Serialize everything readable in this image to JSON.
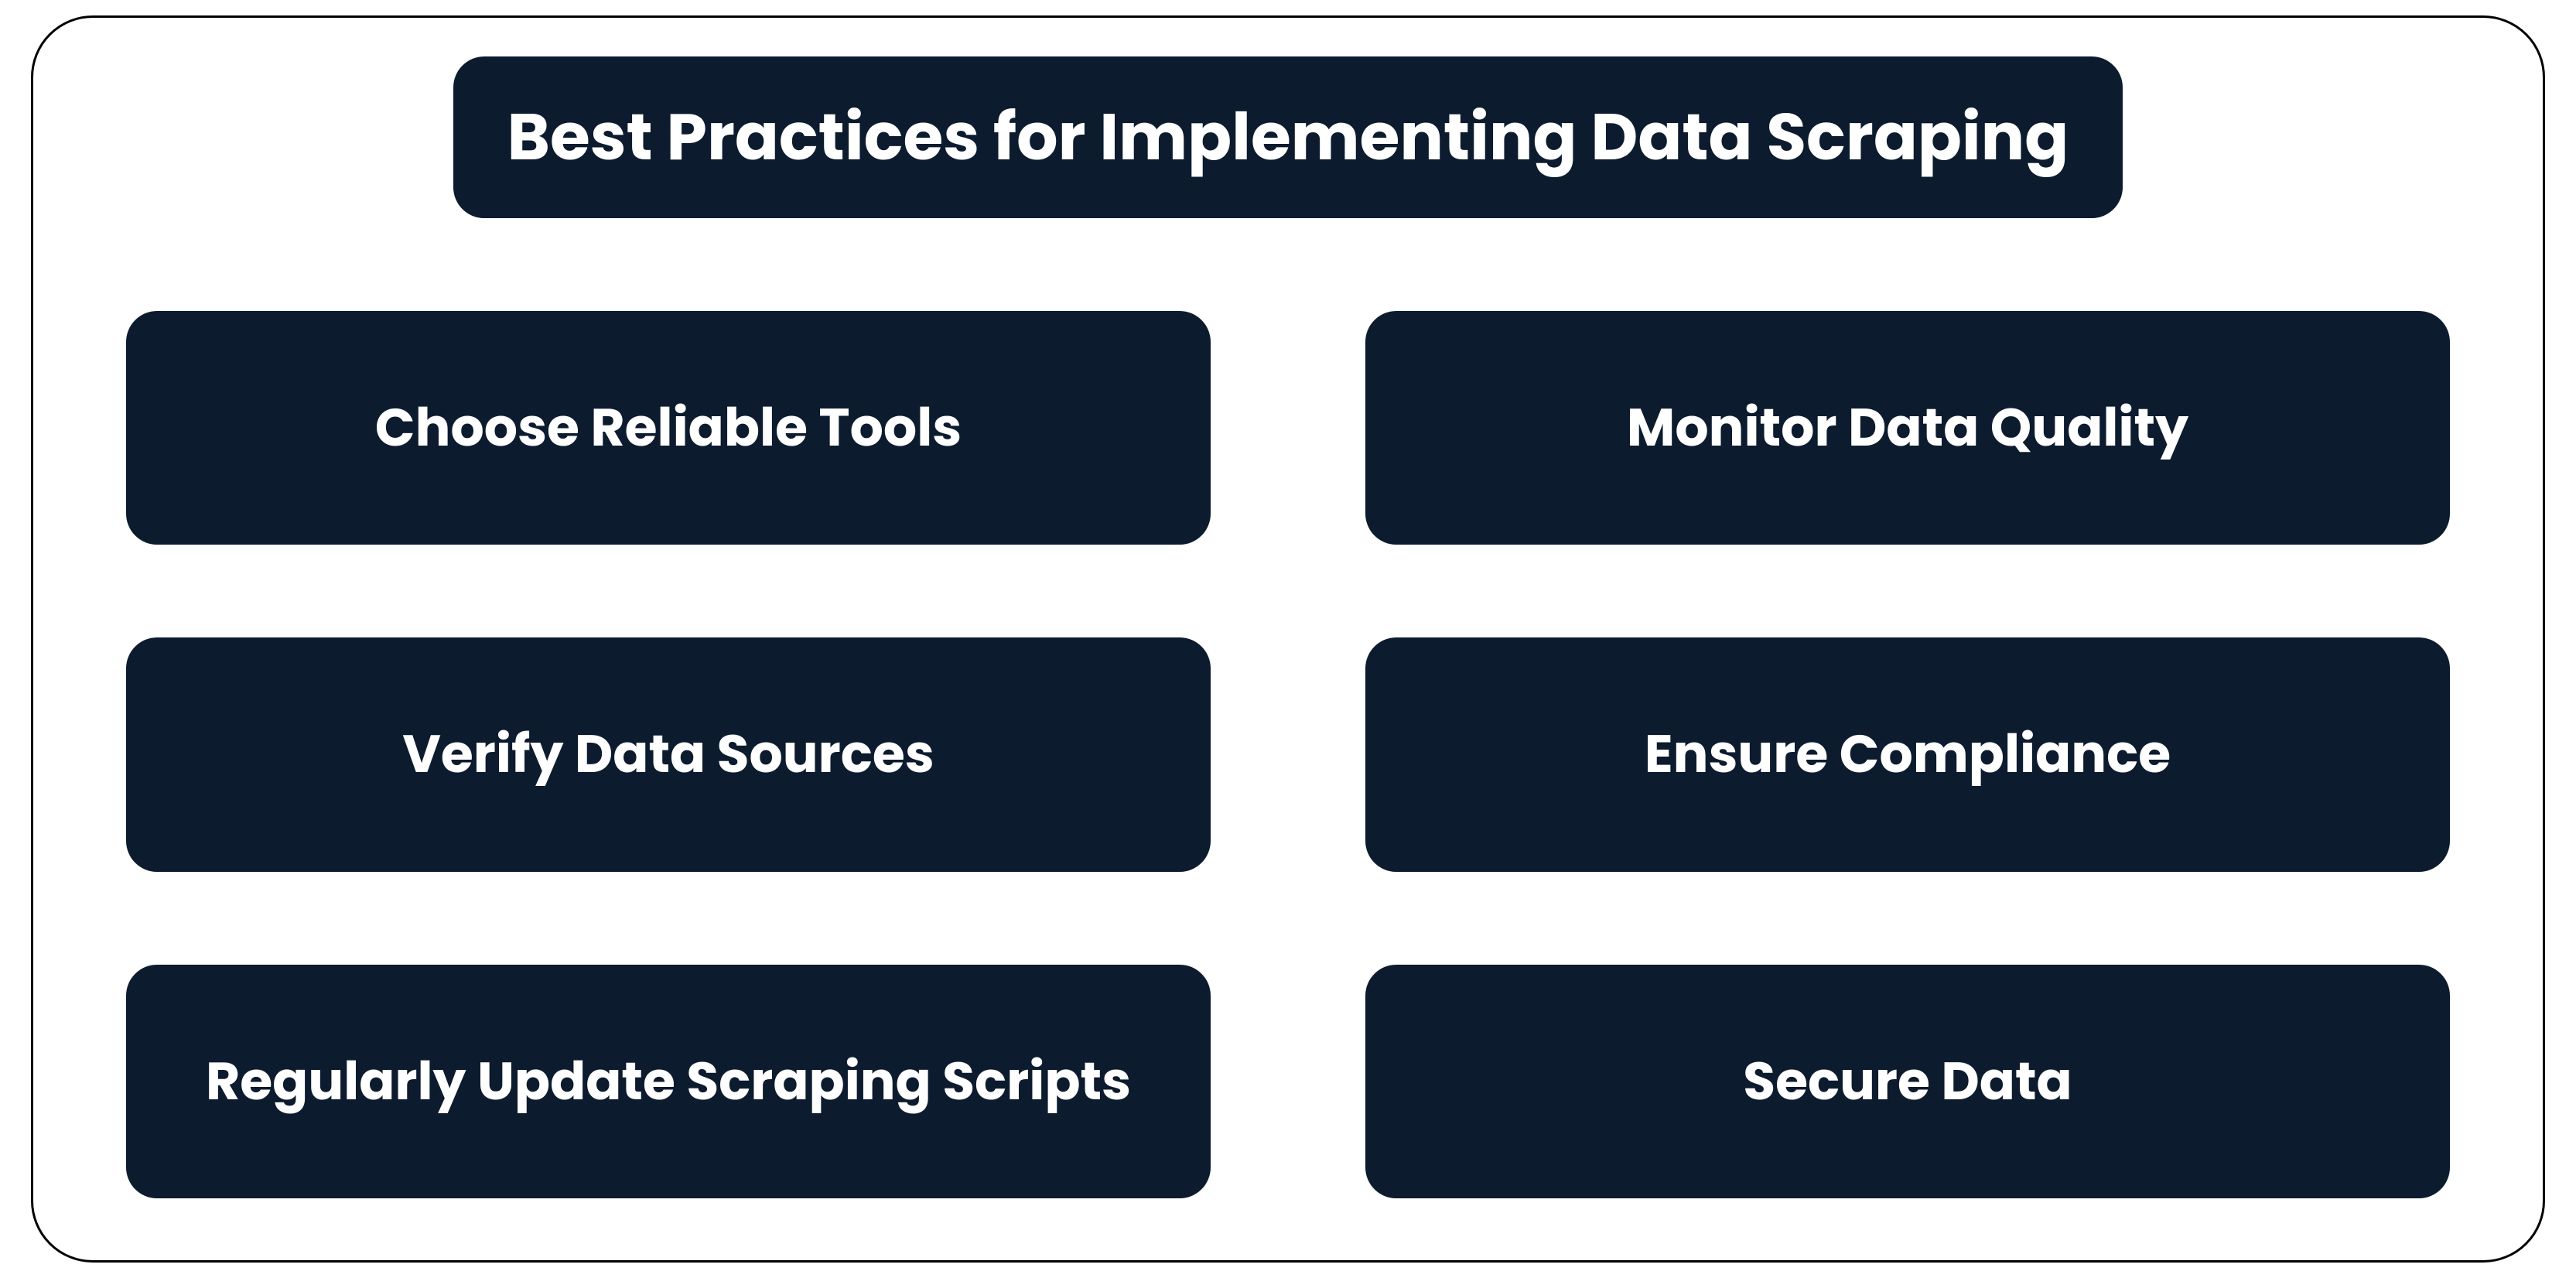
{
  "title": "Best Practices for Implementing Data Scraping",
  "items": [
    {
      "label": "Choose Reliable Tools"
    },
    {
      "label": "Monitor Data Quality"
    },
    {
      "label": "Verify Data Sources"
    },
    {
      "label": "Ensure Compliance"
    },
    {
      "label": "Regularly Update Scraping Scripts"
    },
    {
      "label": "Secure Data"
    }
  ],
  "colors": {
    "card_bg": "#0c1b2e",
    "card_text": "#ffffff",
    "border": "#000000",
    "page_bg": "#ffffff"
  }
}
